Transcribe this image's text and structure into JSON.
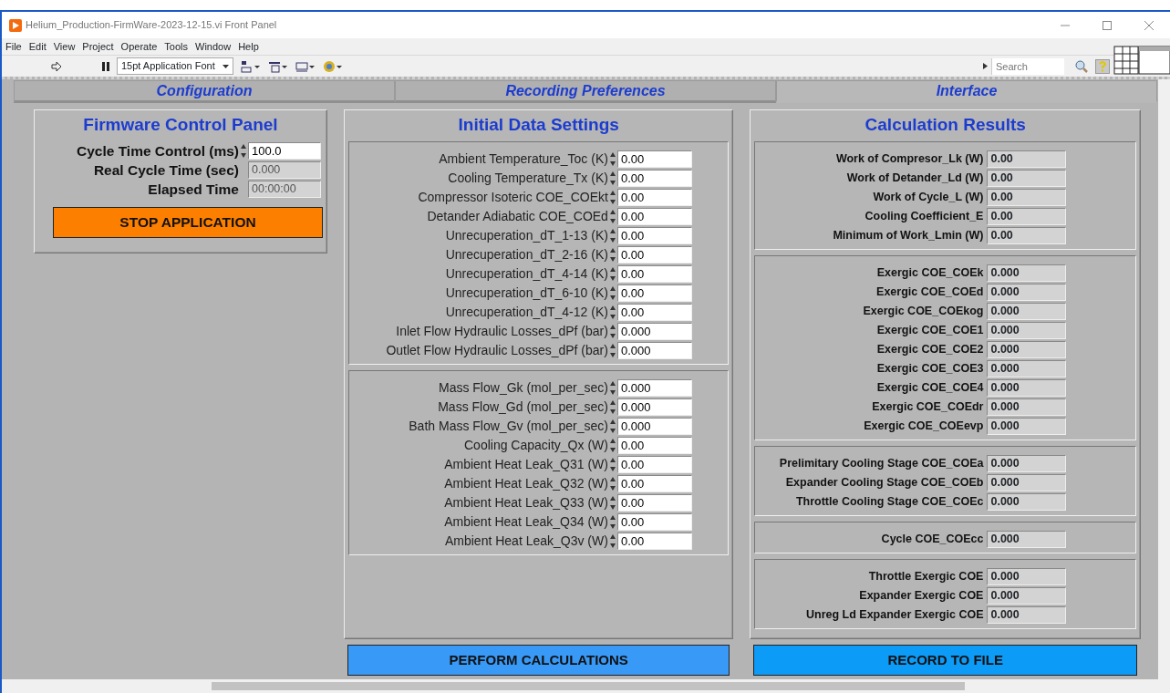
{
  "window": {
    "title": "Helium_Production-FirmWare-2023-12-15.vi Front Panel"
  },
  "menu": [
    "File",
    "Edit",
    "View",
    "Project",
    "Operate",
    "Tools",
    "Window",
    "Help"
  ],
  "toolbar": {
    "font": "15pt Application Font",
    "search_placeholder": "Search"
  },
  "tabs": [
    {
      "label": "Configuration",
      "selected": false
    },
    {
      "label": "Recording Preferences",
      "selected": false
    },
    {
      "label": "Interface",
      "selected": true
    }
  ],
  "firmware_panel": {
    "title": "Firmware Control Panel",
    "fields": [
      {
        "label": "Cycle Time Control (ms)",
        "value": "100.0",
        "kind": "control"
      },
      {
        "label": "Real Cycle Time (sec)",
        "value": "0.000",
        "kind": "indicator"
      },
      {
        "label": "Elapsed Time",
        "value": "00:00:00",
        "kind": "indicator"
      }
    ],
    "button": "STOP APPLICATION"
  },
  "initial_data": {
    "title": "Initial Data Settings",
    "groups": [
      {
        "fields": [
          {
            "label": "Ambient Temperature_Toc (K)",
            "value": "0.00"
          },
          {
            "label": "Cooling Temperature_Tx (K)",
            "value": "0.00"
          },
          {
            "label": "Compressor Isoteric COE_COEkt",
            "value": "0.00"
          },
          {
            "label": "Detander Adiabatic COE_COEd",
            "value": "0.00"
          },
          {
            "label": "Unrecuperation_dT_1-13 (K)",
            "value": "0.00"
          },
          {
            "label": "Unrecuperation_dT_2-16 (K)",
            "value": "0.00"
          },
          {
            "label": "Unrecuperation_dT_4-14 (K)",
            "value": "0.00"
          },
          {
            "label": "Unrecuperation_dT_6-10 (K)",
            "value": "0.00"
          },
          {
            "label": "Unrecuperation_dT_4-12 (K)",
            "value": "0.00"
          },
          {
            "label": "Inlet Flow Hydraulic Losses_dPf (bar)",
            "value": "0.000"
          },
          {
            "label": "Outlet Flow Hydraulic Losses_dPf (bar)",
            "value": "0.000"
          }
        ]
      },
      {
        "fields": [
          {
            "label": "Mass Flow_Gk (mol_per_sec)",
            "value": "0.000"
          },
          {
            "label": "Mass Flow_Gd (mol_per_sec)",
            "value": "0.000"
          },
          {
            "label": "Bath Mass Flow_Gv (mol_per_sec)",
            "value": "0.000"
          },
          {
            "label": "Cooling Capacity_Qx (W)",
            "value": "0.00"
          },
          {
            "label": "Ambient Heat Leak_Q31 (W)",
            "value": "0.00"
          },
          {
            "label": "Ambient Heat Leak_Q32 (W)",
            "value": "0.00"
          },
          {
            "label": "Ambient Heat Leak_Q33 (W)",
            "value": "0.00"
          },
          {
            "label": "Ambient Heat Leak_Q34 (W)",
            "value": "0.00"
          },
          {
            "label": "Ambient Heat Leak_Q3v (W)",
            "value": "0.00"
          }
        ]
      }
    ]
  },
  "results": {
    "title": "Calculation Results",
    "groups": [
      {
        "fields": [
          {
            "label": "Work of Compresor_Lk (W)",
            "value": "0.00"
          },
          {
            "label": "Work of Detander_Ld (W)",
            "value": "0.00"
          },
          {
            "label": "Work of Cycle_L (W)",
            "value": "0.00"
          },
          {
            "label": "Cooling Coefficient_E",
            "value": "0.00"
          },
          {
            "label": "Minimum of Work_Lmin (W)",
            "value": "0.00"
          }
        ]
      },
      {
        "fields": [
          {
            "label": "Exergic COE_COEk",
            "value": "0.000"
          },
          {
            "label": "Exergic COE_COEd",
            "value": "0.000"
          },
          {
            "label": "Exergic COE_COEkog",
            "value": "0.000"
          },
          {
            "label": "Exergic COE_COE1",
            "value": "0.000"
          },
          {
            "label": "Exergic COE_COE2",
            "value": "0.000"
          },
          {
            "label": "Exergic COE_COE3",
            "value": "0.000"
          },
          {
            "label": "Exergic COE_COE4",
            "value": "0.000"
          },
          {
            "label": "Exergic COE_COEdr",
            "value": "0.000"
          },
          {
            "label": "Exergic COE_COEevp",
            "value": "0.000"
          }
        ]
      },
      {
        "fields": [
          {
            "label": "Prelimitary Cooling Stage COE_COEa",
            "value": "0.000"
          },
          {
            "label": "Expander Cooling Stage COE_COEb",
            "value": "0.000"
          },
          {
            "label": "Throttle Cooling Stage COE_COEc",
            "value": "0.000"
          }
        ]
      },
      {
        "fields": [
          {
            "label": "Cycle COE_COEcc",
            "value": "0.000"
          }
        ]
      },
      {
        "fields": [
          {
            "label": "Throttle Exergic COE",
            "value": "0.000"
          },
          {
            "label": "Expander Exergic COE",
            "value": "0.000"
          },
          {
            "label": "Unreg Ld Expander Exergic COE",
            "value": "0.000"
          }
        ]
      }
    ]
  },
  "buttons": [
    "PERFORM CALCULATIONS",
    "RECORD TO FILE"
  ]
}
